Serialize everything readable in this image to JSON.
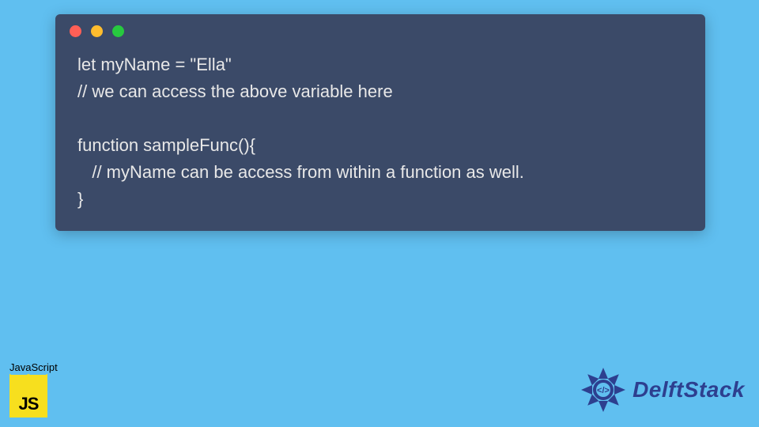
{
  "code": {
    "line1": "let myName = \"Ella\"",
    "line2": "// we can access the above variable here",
    "line3": "",
    "line4": "function sampleFunc(){",
    "line5": "   // myName can be access from within a function as well.",
    "line6": "}"
  },
  "badge": {
    "label": "JavaScript",
    "logo_text": "JS"
  },
  "brand": {
    "name": "DelftStack"
  }
}
